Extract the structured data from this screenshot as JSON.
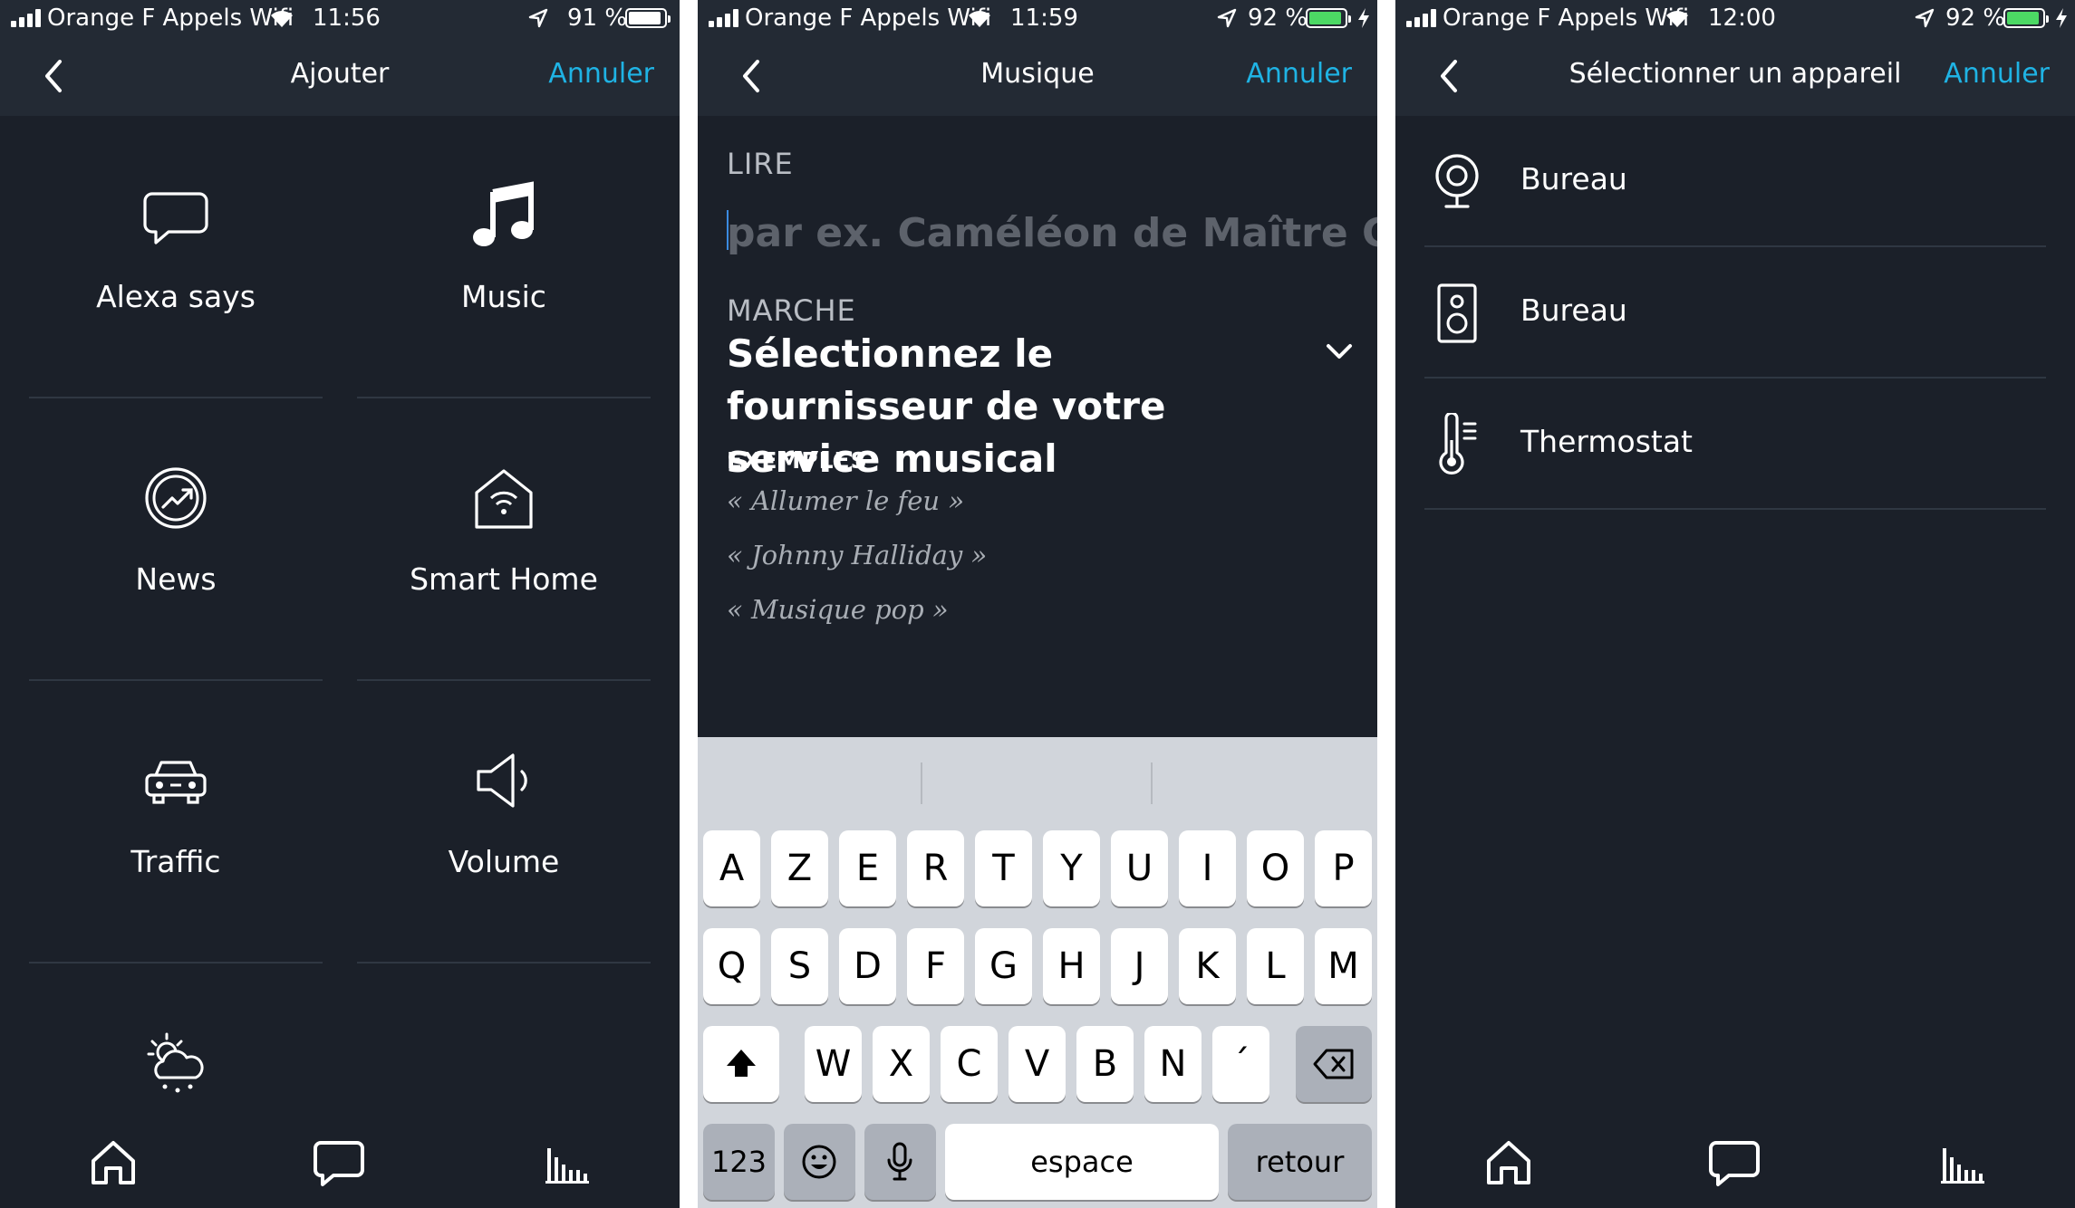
{
  "screens": [
    {
      "status": {
        "carrier": "Orange F Appels Wifi",
        "time": "11:56",
        "battery": "91 %",
        "battery_level": 0.91,
        "charging": false
      },
      "nav": {
        "title": "Ajouter",
        "cancel": "Annuler"
      },
      "tiles": [
        {
          "label": "Alexa says",
          "icon": "speech-bubble-icon"
        },
        {
          "label": "Music",
          "icon": "music-note-icon"
        },
        {
          "label": "News",
          "icon": "news-icon"
        },
        {
          "label": "Smart Home",
          "icon": "smart-home-icon"
        },
        {
          "label": "Traffic",
          "icon": "car-icon"
        },
        {
          "label": "Volume",
          "icon": "speaker-volume-icon"
        },
        {
          "label": "",
          "icon": "weather-icon"
        }
      ],
      "tabs": [
        "home-icon",
        "chat-icon",
        "activity-icon"
      ]
    },
    {
      "status": {
        "carrier": "Orange F Appels Wifi",
        "time": "11:59",
        "battery": "92 %",
        "battery_level": 0.92,
        "charging": true
      },
      "nav": {
        "title": "Musique",
        "cancel": "Annuler"
      },
      "form": {
        "play_label": "LIRE",
        "play_placeholder": "par ex. Caméléon de Maître G...",
        "on_label": "MARCHE",
        "provider": "Sélectionnez le fournisseur de votre service musical",
        "examples_title": "EXEMPLES",
        "examples": [
          "« Allumer le feu »",
          "« Johnny Halliday »",
          "« Musique pop »"
        ]
      },
      "keyboard": {
        "row1": [
          "A",
          "Z",
          "E",
          "R",
          "T",
          "Y",
          "U",
          "I",
          "O",
          "P"
        ],
        "row2": [
          "Q",
          "S",
          "D",
          "F",
          "G",
          "H",
          "J",
          "K",
          "L",
          "M"
        ],
        "row3": [
          "W",
          "X",
          "C",
          "V",
          "B",
          "N",
          "´"
        ],
        "numbers": "123",
        "space": "espace",
        "return": "retour"
      }
    },
    {
      "status": {
        "carrier": "Orange F Appels Wifi",
        "time": "12:00",
        "battery": "92 %",
        "battery_level": 0.92,
        "charging": true
      },
      "nav": {
        "title": "Sélectionner un appareil",
        "cancel": "Annuler"
      },
      "devices": [
        {
          "name": "Bureau",
          "icon": "echo-spot-icon"
        },
        {
          "name": "Bureau",
          "icon": "speaker-device-icon"
        },
        {
          "name": "Thermostat",
          "icon": "thermometer-icon"
        }
      ],
      "tabs": [
        "home-icon",
        "chat-icon",
        "activity-icon"
      ]
    }
  ],
  "colors": {
    "background": "#1b2029",
    "header": "#232a34",
    "accent": "#1fb3e4",
    "battery_green": "#4cd964"
  }
}
